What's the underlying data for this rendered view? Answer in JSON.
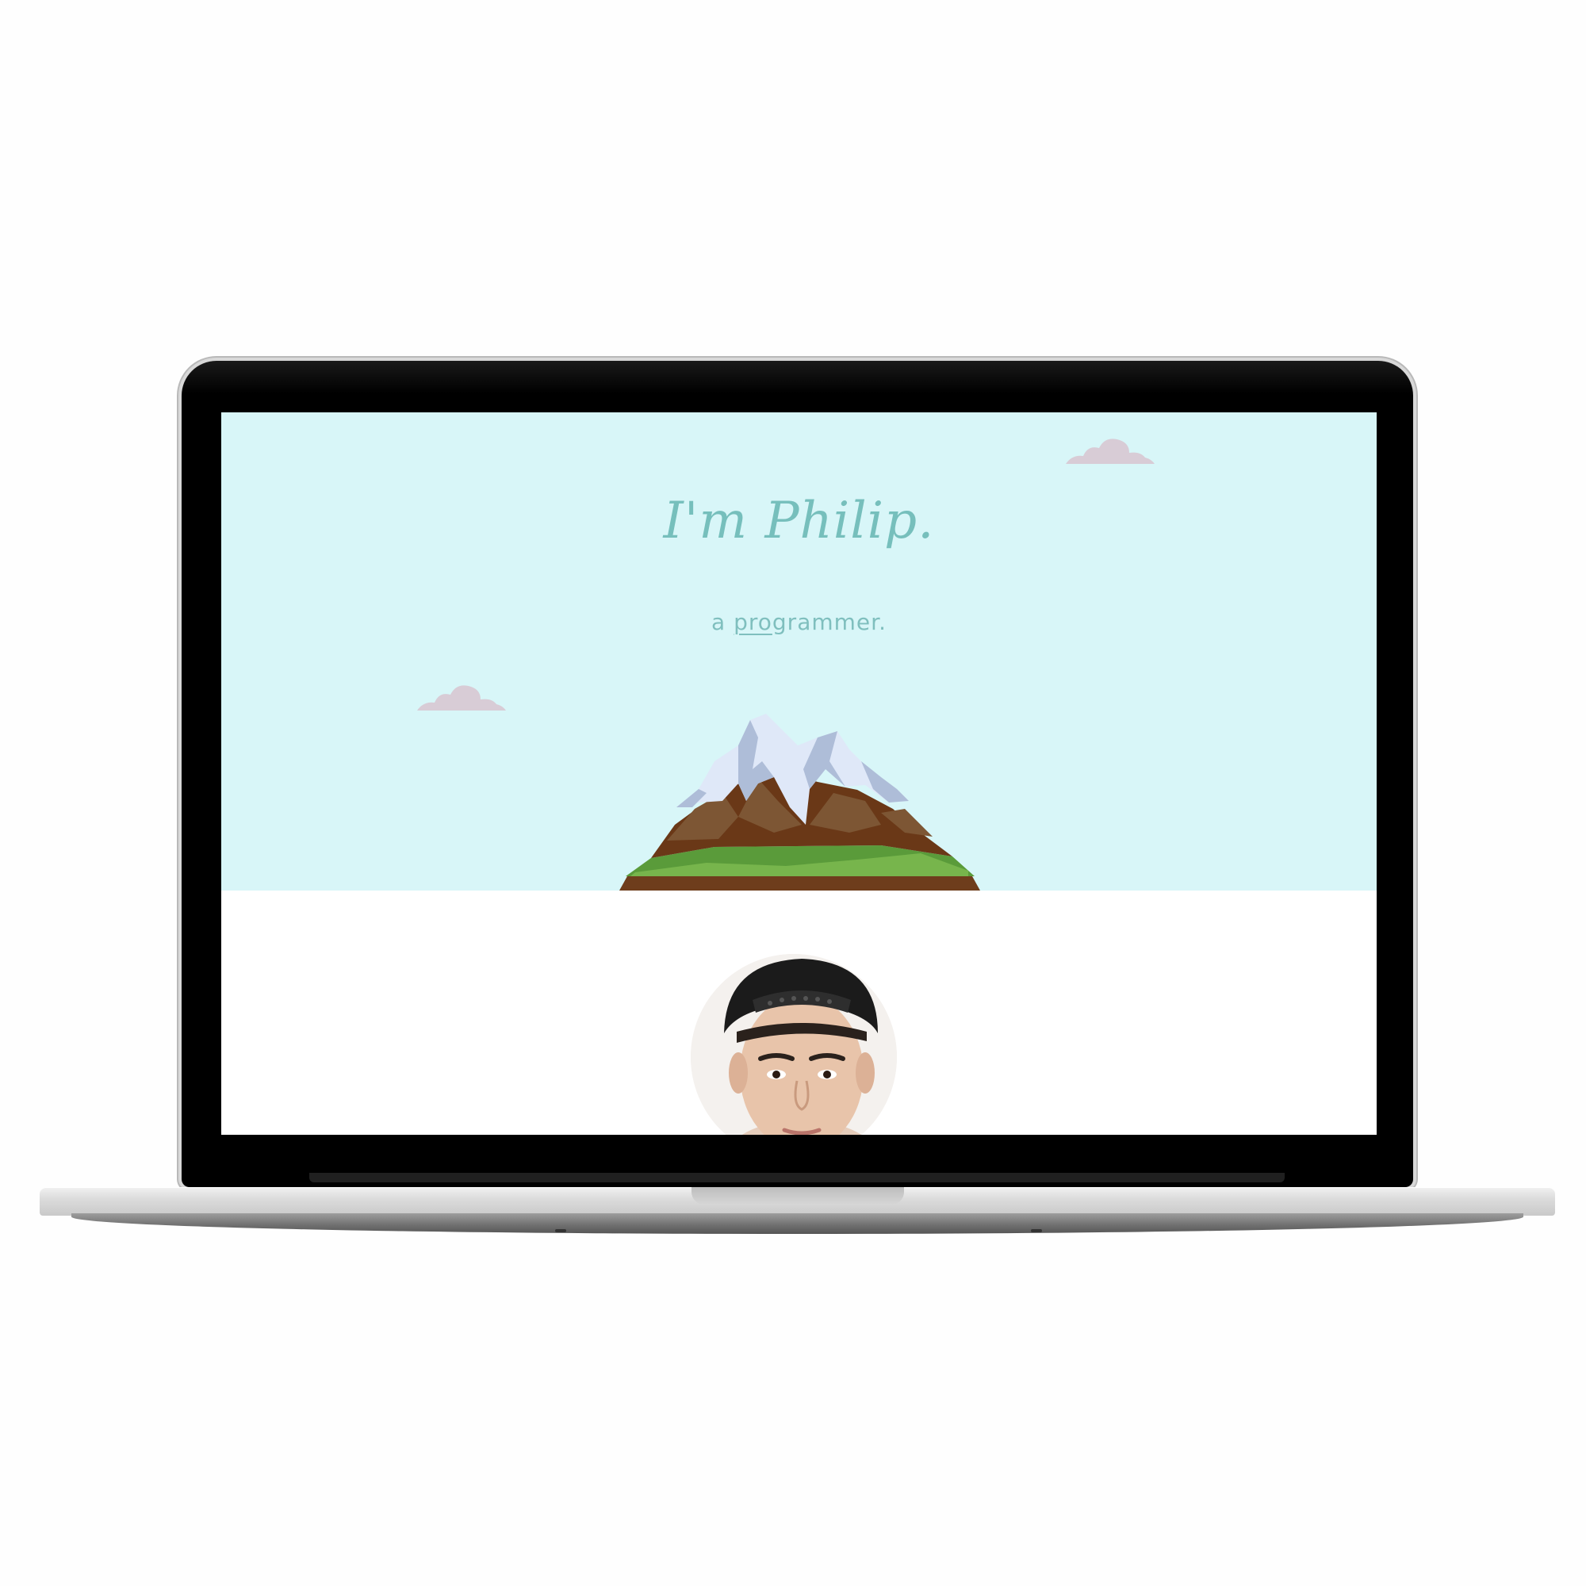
{
  "device": {
    "name": "laptop",
    "bezel_color": "#000000",
    "body_color": "#d9d9d9"
  },
  "site": {
    "hero": {
      "greeting": "I'm Philip.",
      "role_prefix": "a ",
      "role_underlined": "pro",
      "role_rest": "grammer.",
      "background_color": "#d8f6f8",
      "text_color": "#76bfbc"
    },
    "decorations": {
      "cloud_icon": "cloud-icon",
      "cloud_color": "#d8ccd6",
      "mountain_icon": "mountain-icon"
    },
    "profile": {
      "avatar": "profile-photo"
    }
  }
}
